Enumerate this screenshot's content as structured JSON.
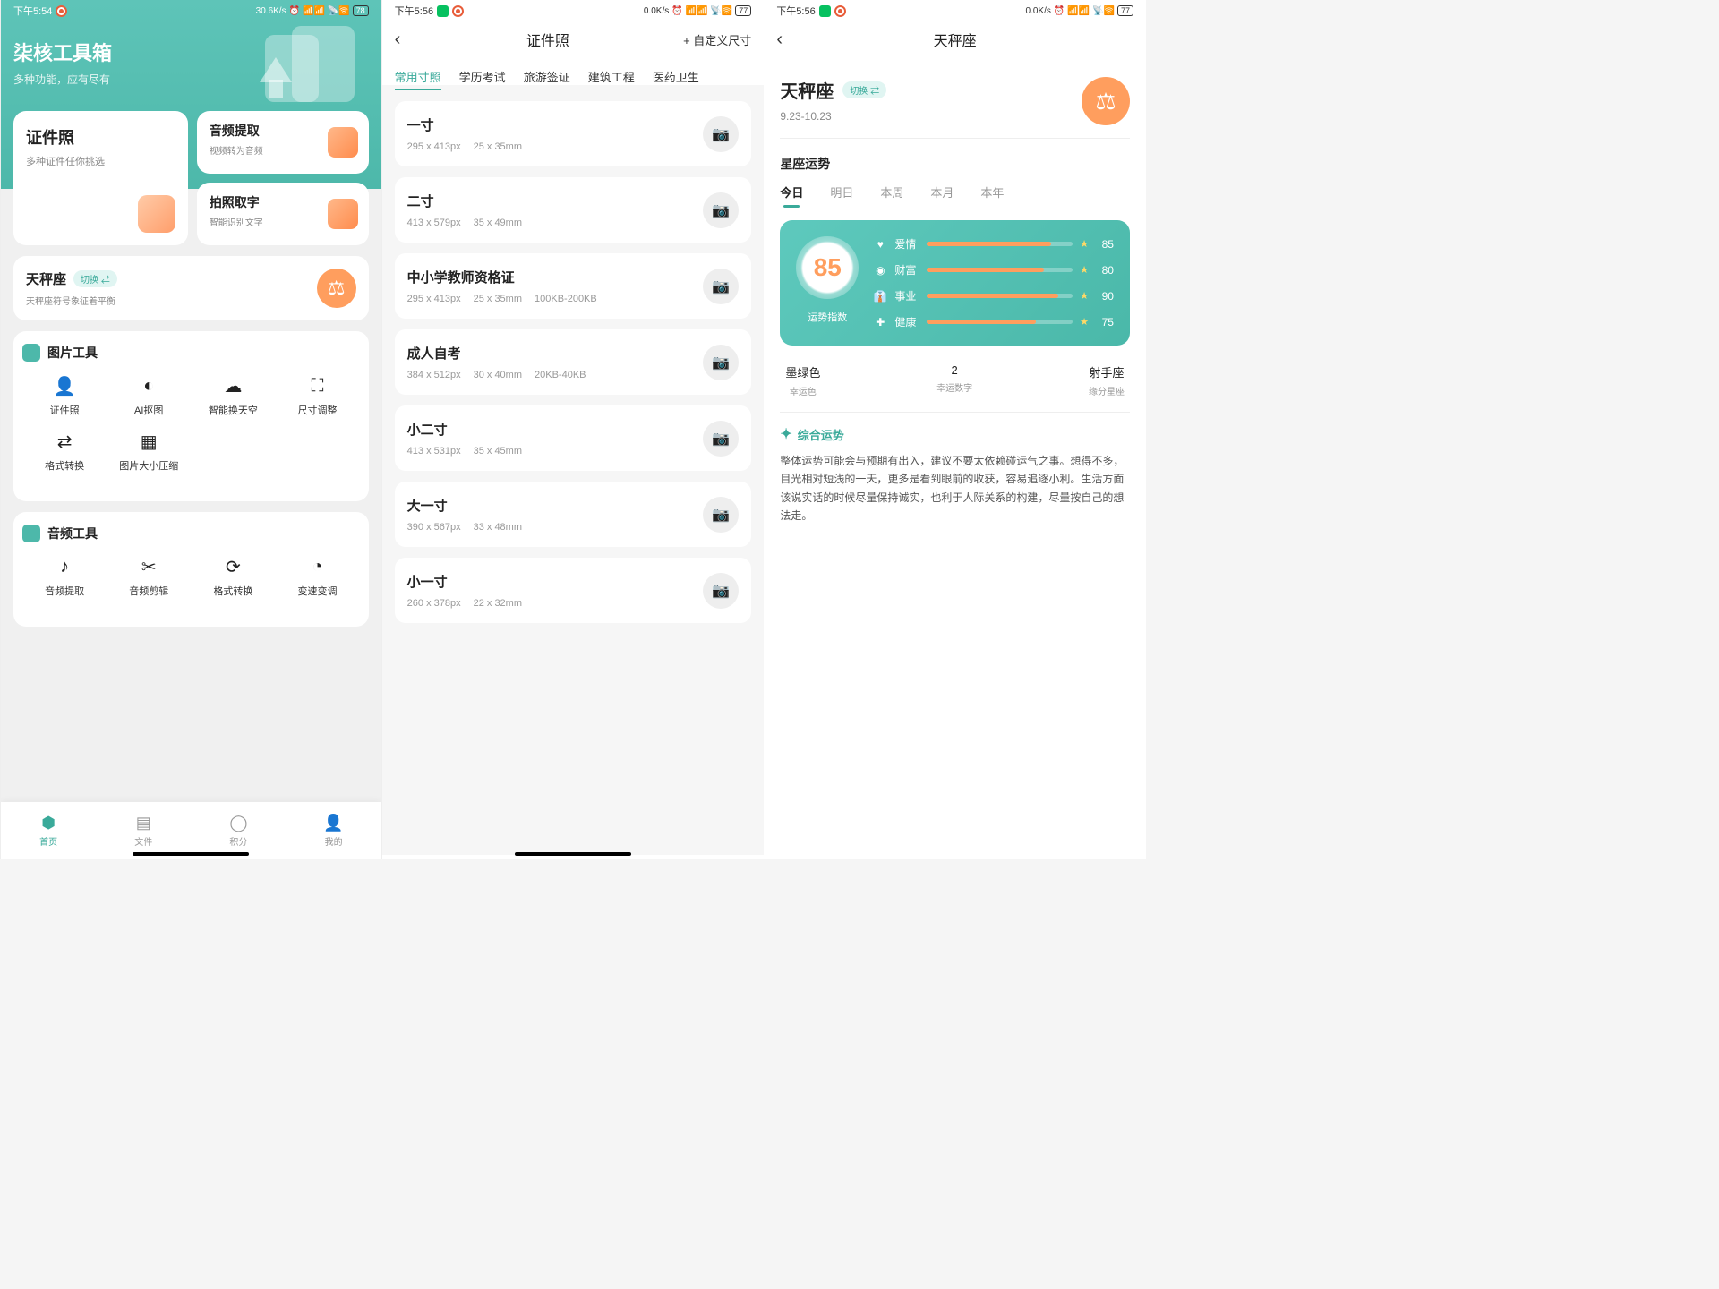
{
  "screen1": {
    "status": {
      "time": "下午5:54",
      "net": "30.6K/s",
      "battery": "78"
    },
    "title": "柒核工具箱",
    "subtitle": "多种功能，应有尽有",
    "idPhoto": {
      "title": "证件照",
      "sub": "多种证件任你挑选"
    },
    "audio": {
      "title": "音频提取",
      "sub": "视频转为音频"
    },
    "ocr": {
      "title": "拍照取字",
      "sub": "智能识别文字"
    },
    "zodiac": {
      "name": "天秤座",
      "switch": "切换 ⇄",
      "sub": "天秤座符号象征着平衡"
    },
    "imgTools": {
      "title": "图片工具",
      "items": [
        "证件照",
        "AI抠图",
        "智能换天空",
        "尺寸调整",
        "格式转换",
        "图片大小压缩"
      ]
    },
    "audioTools": {
      "title": "音频工具",
      "items": [
        "音频提取",
        "音频剪辑",
        "格式转换",
        "变速变调"
      ]
    },
    "nav": [
      "首页",
      "文件",
      "积分",
      "我的"
    ]
  },
  "screen2": {
    "status": {
      "time": "下午5:56",
      "net": "0.0K/s",
      "battery": "77"
    },
    "title": "证件照",
    "custom": "+ 自定义尺寸",
    "tabs": [
      "常用寸照",
      "学历考试",
      "旅游签证",
      "建筑工程",
      "医药卫生"
    ],
    "items": [
      {
        "name": "一寸",
        "px": "295 x 413px",
        "mm": "25 x 35mm",
        "kb": ""
      },
      {
        "name": "二寸",
        "px": "413 x 579px",
        "mm": "35 x 49mm",
        "kb": ""
      },
      {
        "name": "中小学教师资格证",
        "px": "295 x 413px",
        "mm": "25 x 35mm",
        "kb": "100KB-200KB"
      },
      {
        "name": "成人自考",
        "px": "384 x 512px",
        "mm": "30 x 40mm",
        "kb": "20KB-40KB"
      },
      {
        "name": "小二寸",
        "px": "413 x 531px",
        "mm": "35 x 45mm",
        "kb": ""
      },
      {
        "name": "大一寸",
        "px": "390 x 567px",
        "mm": "33 x 48mm",
        "kb": ""
      },
      {
        "name": "小一寸",
        "px": "260 x 378px",
        "mm": "22 x 32mm",
        "kb": ""
      }
    ]
  },
  "screen3": {
    "status": {
      "time": "下午5:56",
      "net": "0.0K/s",
      "battery": "77"
    },
    "title": "天秤座",
    "zodiac": {
      "name": "天秤座",
      "switch": "切换 ⇄",
      "date": "9.23-10.23"
    },
    "section": "星座运势",
    "tabs": [
      "今日",
      "明日",
      "本周",
      "本月",
      "本年"
    ],
    "score": "85",
    "scoreLabel": "运势指数",
    "metrics": [
      {
        "icon": "♥",
        "label": "爱情",
        "val": 85
      },
      {
        "icon": "◉",
        "label": "财富",
        "val": 80
      },
      {
        "icon": "👔",
        "label": "事业",
        "val": 90
      },
      {
        "icon": "✚",
        "label": "健康",
        "val": 75
      }
    ],
    "lucky": [
      {
        "val": "墨绿色",
        "label": "幸运色"
      },
      {
        "val": "2",
        "label": "幸运数字"
      },
      {
        "val": "射手座",
        "label": "缘分星座"
      }
    ],
    "analysis": {
      "title": "综合运势",
      "text": "整体运势可能会与预期有出入，建议不要太依赖碰运气之事。想得不多，目光相对短浅的一天，更多是看到眼前的收获，容易追逐小利。生活方面该说实话的时候尽量保持诚实，也利于人际关系的构建，尽量按自己的想法走。"
    }
  }
}
